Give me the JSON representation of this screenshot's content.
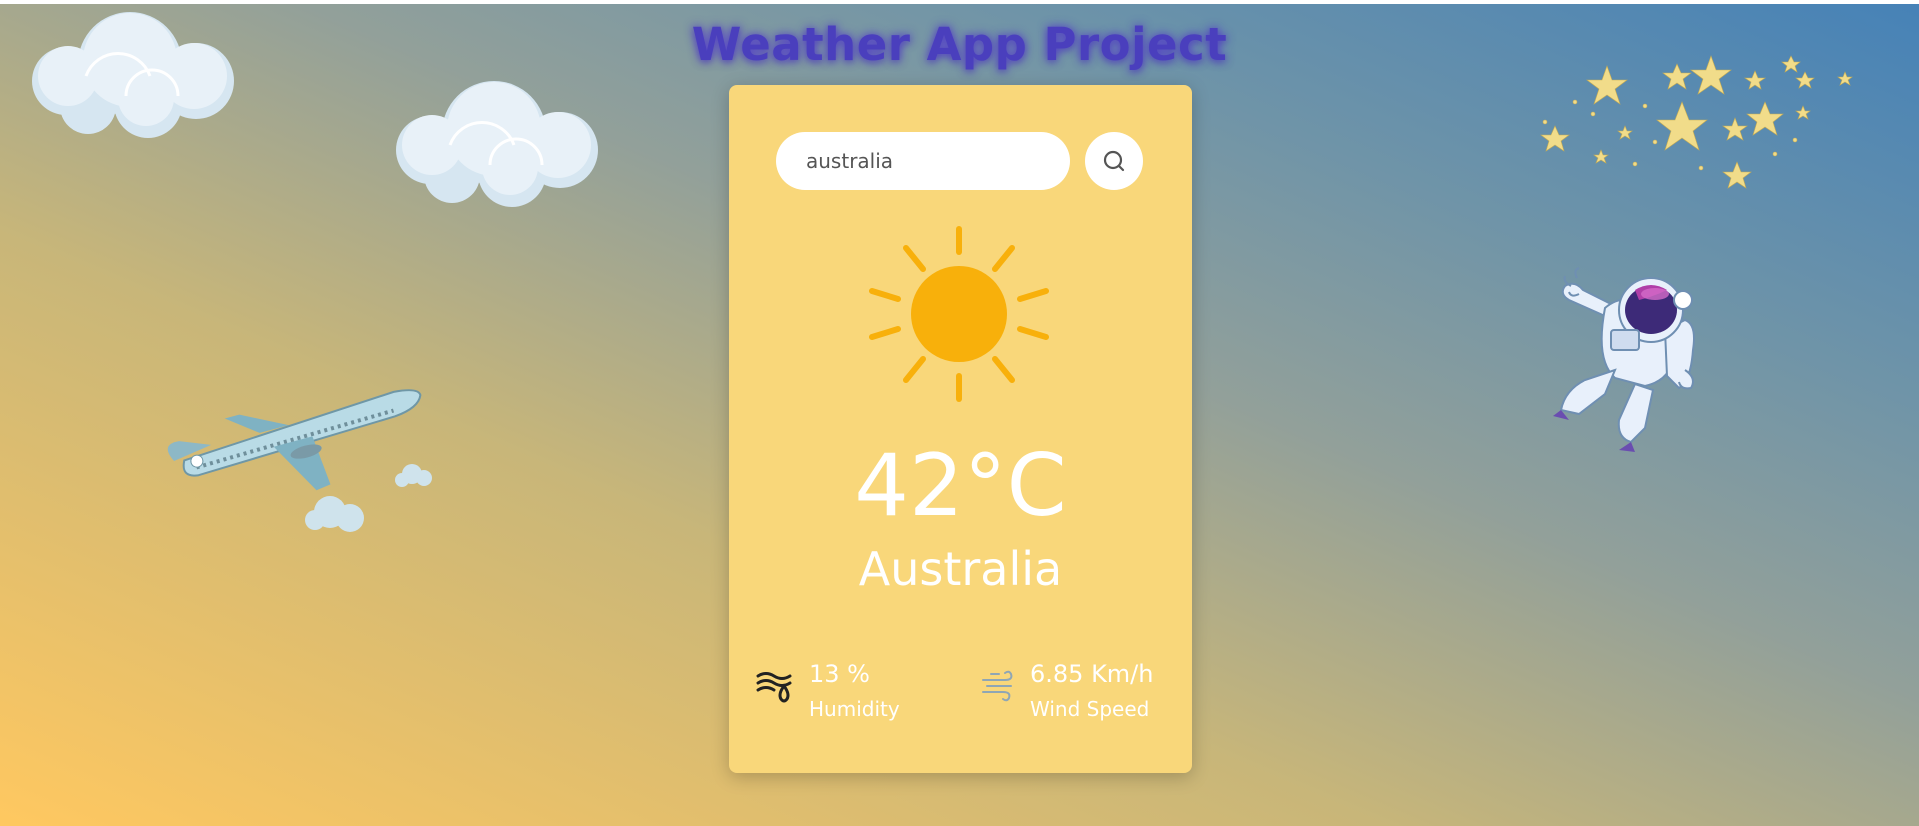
{
  "app": {
    "title": "Weather App Project"
  },
  "search": {
    "value": "australia",
    "button_icon": "search-icon"
  },
  "weather": {
    "icon": "sun-icon",
    "temperature": "42°C",
    "city": "Australia"
  },
  "details": {
    "humidity": {
      "value": "13 %",
      "label": "Humidity",
      "icon": "humidity-icon"
    },
    "wind": {
      "value": "6.85 Km/h",
      "label": "Wind Speed",
      "icon": "wind-icon"
    }
  },
  "colors": {
    "card": "#f9d77a",
    "sun": "#f8b00b",
    "title": "#4a3fbd",
    "gradient_start": "#ffc860",
    "gradient_end": "#4682b7"
  }
}
